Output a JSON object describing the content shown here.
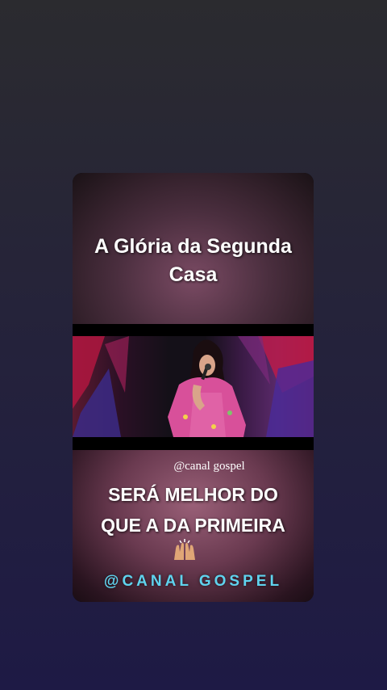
{
  "post": {
    "title_line1": "A Glória da Segunda",
    "title_line2": "Casa",
    "handle": "@canal gospel",
    "caption_line1": "SERÁ MELHOR DO",
    "caption_line2": "QUE A DA PRIMEIRA",
    "emoji": "praying-hands",
    "brand": "@CANAL GOSPEL"
  },
  "colors": {
    "brand": "#5fd3ee",
    "dress": "#d8509a",
    "stage_red": "#c0184a",
    "stage_blue": "#3a2a8a"
  }
}
